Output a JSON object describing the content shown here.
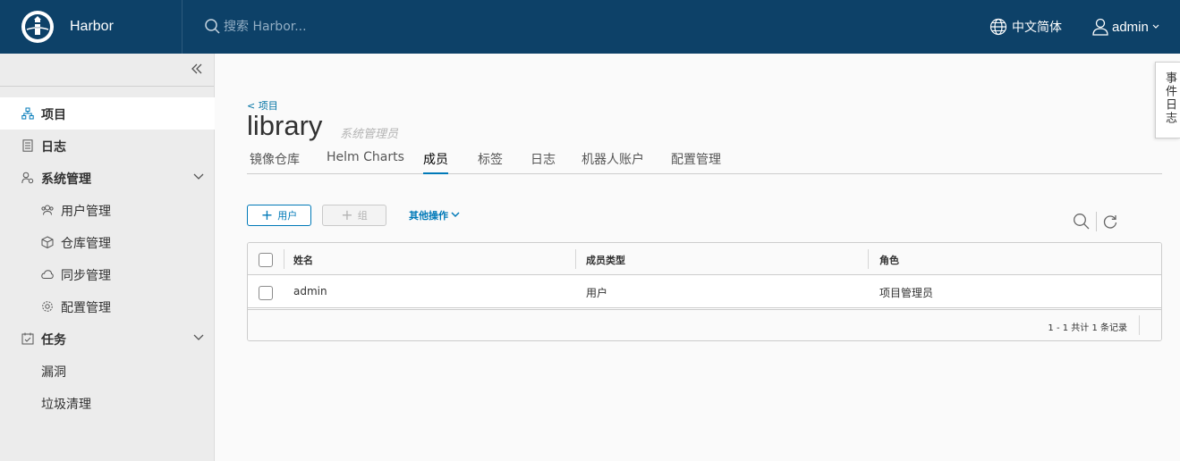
{
  "header": {
    "brand": "Harbor",
    "search_placeholder": "搜索 Harbor...",
    "language": "中文简体",
    "user": "admin"
  },
  "sidebar": {
    "items": [
      {
        "label": "项目",
        "icon": "project-icon",
        "active": true
      },
      {
        "label": "日志",
        "icon": "log-icon"
      },
      {
        "label": "系统管理",
        "icon": "admin-icon",
        "expandable": true
      },
      {
        "label": "用户管理",
        "icon": "users-icon"
      },
      {
        "label": "仓库管理",
        "icon": "registry-icon"
      },
      {
        "label": "同步管理",
        "icon": "replication-icon"
      },
      {
        "label": "配置管理",
        "icon": "config-icon"
      },
      {
        "label": "任务",
        "icon": "tasks-icon",
        "expandable": true
      },
      {
        "label": "漏洞"
      },
      {
        "label": "垃圾清理"
      }
    ]
  },
  "event_log_tab": "事件日志",
  "page": {
    "back_link": "< 项目",
    "title": "library",
    "role": "系统管理员",
    "tabs": [
      "镜像仓库",
      "Helm Charts",
      "成员",
      "标签",
      "日志",
      "机器人账户",
      "配置管理"
    ],
    "active_tab": "成员"
  },
  "toolbar": {
    "add_user": "用户",
    "add_group": "组",
    "more_actions": "其他操作"
  },
  "grid": {
    "columns": [
      "姓名",
      "成员类型",
      "角色"
    ],
    "rows": [
      {
        "name": "admin",
        "type": "用户",
        "role": "项目管理员"
      }
    ],
    "footer": "1 - 1 共计 1 条记录"
  },
  "colors": {
    "header_bg": "#0d4168",
    "accent": "#0079b8"
  }
}
